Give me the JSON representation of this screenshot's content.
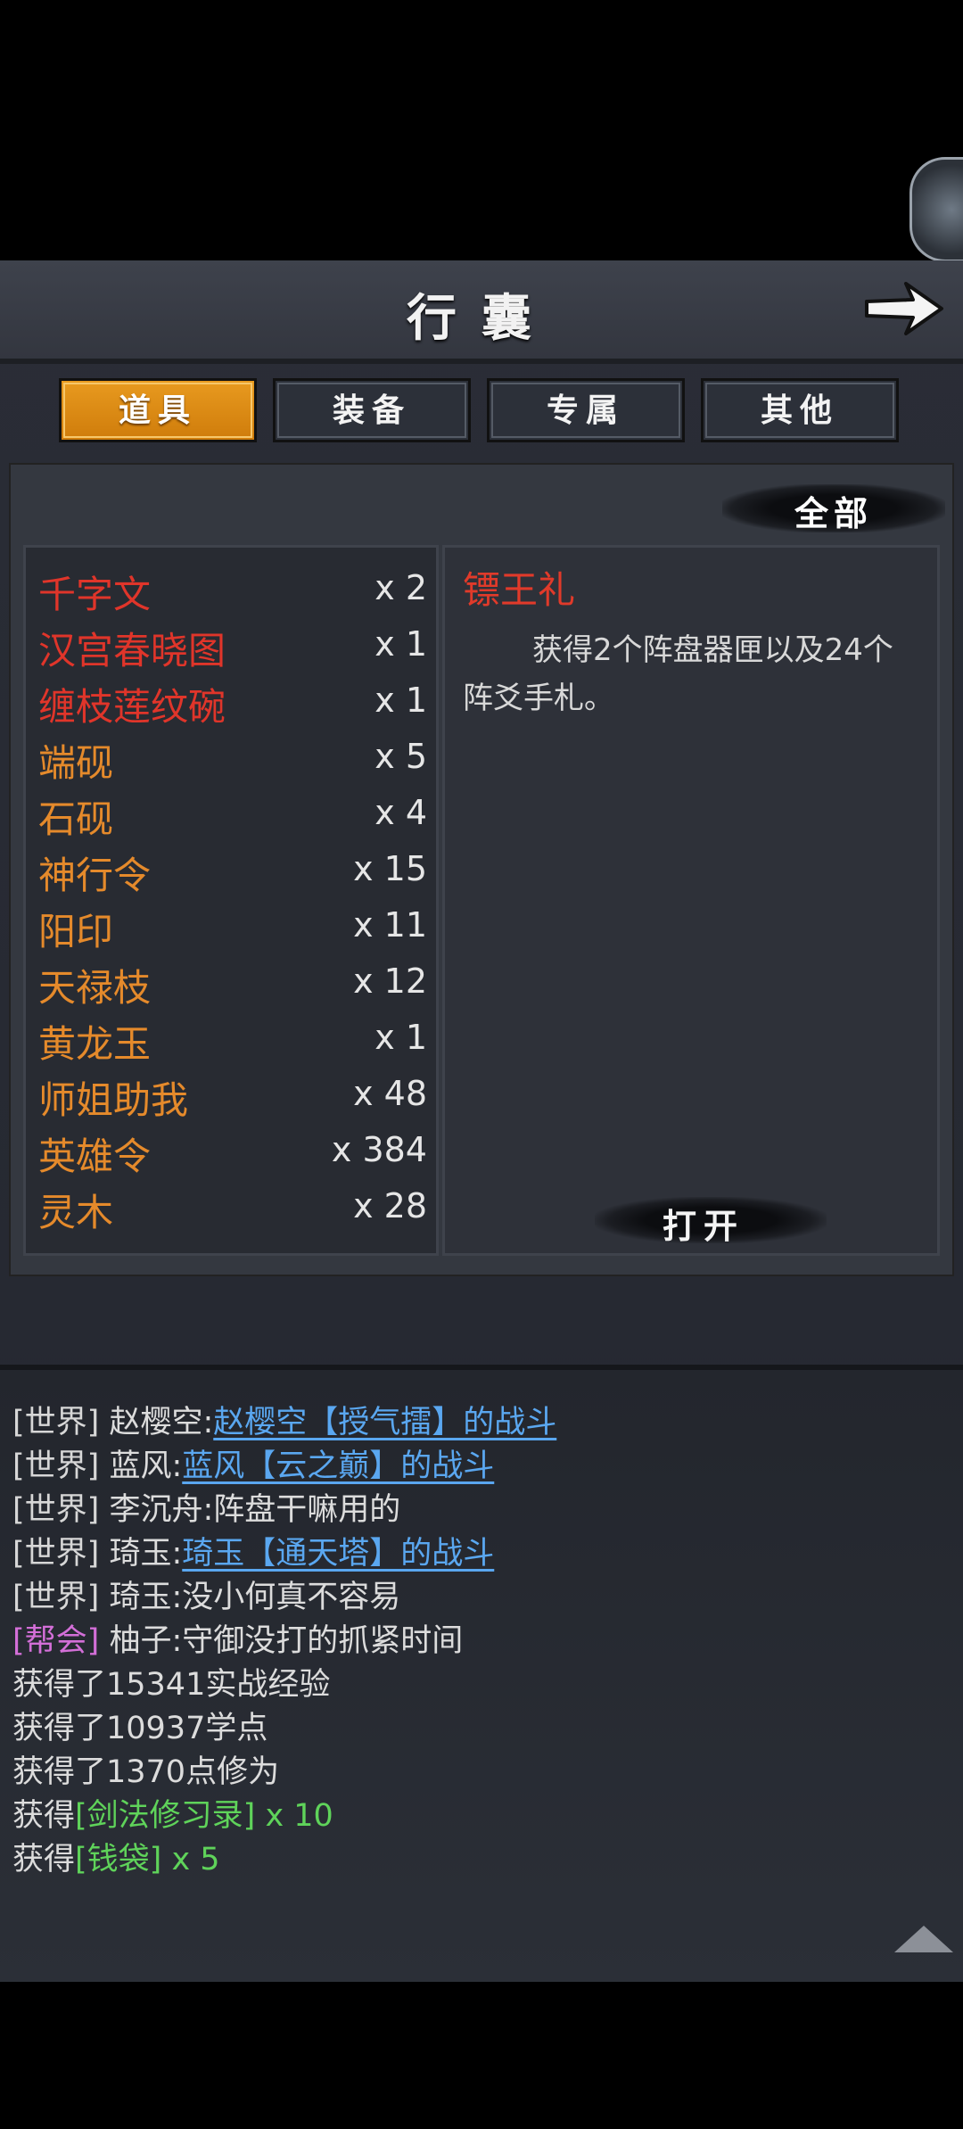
{
  "header": {
    "title": "行囊"
  },
  "tabs": [
    {
      "label": "道具",
      "active": true
    },
    {
      "label": "装备",
      "active": false
    },
    {
      "label": "专属",
      "active": false
    },
    {
      "label": "其他",
      "active": false
    }
  ],
  "filter": {
    "label": "全部"
  },
  "items": [
    {
      "name": "千字文",
      "count": "x 2",
      "color": "#e0352a"
    },
    {
      "name": "汉宫春晓图",
      "count": "x 1",
      "color": "#e0352a"
    },
    {
      "name": "缠枝莲纹碗",
      "count": "x 1",
      "color": "#e0352a"
    },
    {
      "name": "端砚",
      "count": "x 5",
      "color": "#e58a2b"
    },
    {
      "name": "石砚",
      "count": "x 4",
      "color": "#e58a2b"
    },
    {
      "name": "神行令",
      "count": "x 15",
      "color": "#e58a2b"
    },
    {
      "name": "阳印",
      "count": "x 11",
      "color": "#e58a2b"
    },
    {
      "name": "天禄枝",
      "count": "x 12",
      "color": "#e58a2b"
    },
    {
      "name": "黄龙玉",
      "count": "x 1",
      "color": "#e58a2b"
    },
    {
      "name": "师姐助我",
      "count": "x 48",
      "color": "#e58a2b"
    },
    {
      "name": "英雄令",
      "count": "x 384",
      "color": "#e58a2b"
    },
    {
      "name": "灵木",
      "count": "x 28",
      "color": "#e58a2b"
    }
  ],
  "detail": {
    "title": "镖王礼",
    "description": "获得2个阵盘器匣以及24个阵爻手札。",
    "open_label": "打开"
  },
  "chat": [
    {
      "channel": "[世界]",
      "speaker": "赵樱空:",
      "link": "赵樱空【授气擂】的战斗"
    },
    {
      "channel": "[世界]",
      "speaker": "蓝风:",
      "link": "蓝风【云之巅】的战斗"
    },
    {
      "channel": "[世界]",
      "speaker": "李沉舟:",
      "text": "阵盘干嘛用的"
    },
    {
      "channel": "[世界]",
      "speaker": "琦玉:",
      "link": "琦玉【通天塔】的战斗"
    },
    {
      "channel": "[世界]",
      "speaker": "琦玉:",
      "text": "没小何真不容易"
    },
    {
      "channel": "[帮会]",
      "speaker": "柚子:",
      "text": "守御没打的抓紧时间"
    }
  ],
  "system": [
    {
      "text": "获得了15341实战经验"
    },
    {
      "text": "获得了10937学点"
    },
    {
      "text": "获得了1370点修为"
    },
    {
      "prefix": "获得",
      "reward": "[剑法修习录] x 10"
    },
    {
      "prefix": "获得",
      "reward": "[钱袋] x 5"
    }
  ],
  "icons": {
    "back": "arrow-right-icon",
    "scroll": "triangle-up-icon"
  }
}
